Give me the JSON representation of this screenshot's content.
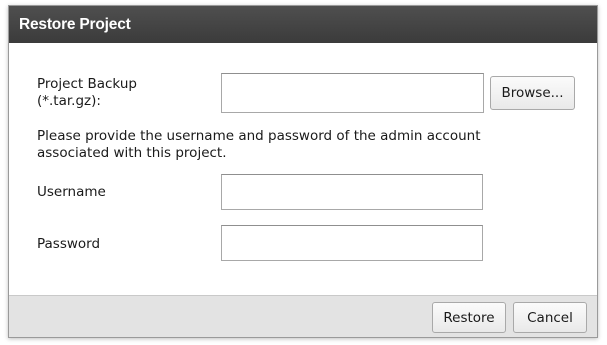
{
  "dialog": {
    "title": "Restore Project",
    "backup": {
      "label_line1": "Project Backup",
      "label_line2": "(*.tar.gz):",
      "value": "",
      "browse_label": "Browse..."
    },
    "instructions_line1": "Please provide the username and password of the admin account",
    "instructions_line2": "associated with this project.",
    "username": {
      "label": "Username",
      "value": ""
    },
    "password": {
      "label": "Password",
      "value": ""
    },
    "footer": {
      "restore_label": "Restore",
      "cancel_label": "Cancel"
    }
  },
  "colors": {
    "titlebar": "#444444",
    "footer": "#e3e3e3",
    "border": "#a8a8a8"
  }
}
